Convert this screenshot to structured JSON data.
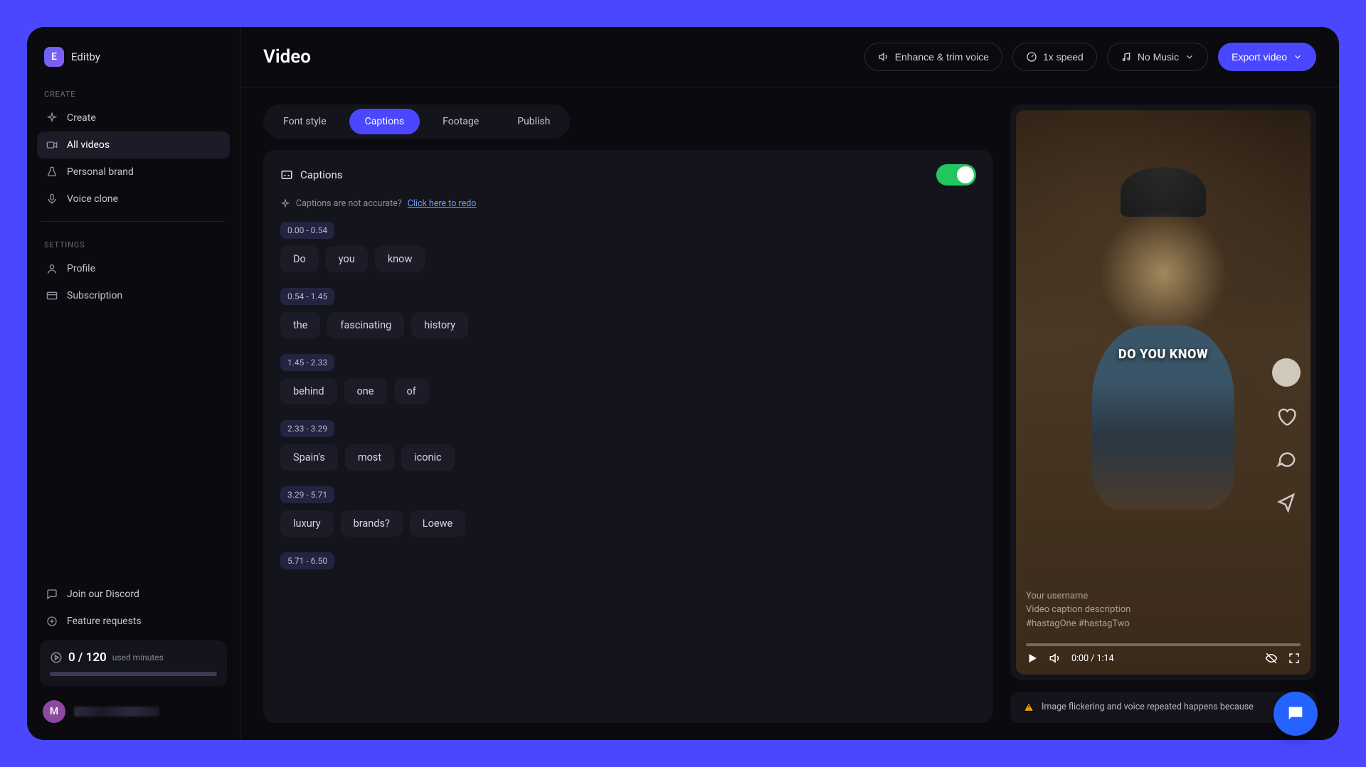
{
  "brand": {
    "initial": "E",
    "name": "Editby"
  },
  "sidebar": {
    "section_create": "CREATE",
    "section_settings": "SETTINGS",
    "items_create": [
      {
        "label": "Create"
      },
      {
        "label": "All videos"
      },
      {
        "label": "Personal brand"
      },
      {
        "label": "Voice clone"
      }
    ],
    "items_settings": [
      {
        "label": "Profile"
      },
      {
        "label": "Subscription"
      }
    ],
    "footer": [
      {
        "label": "Join our Discord"
      },
      {
        "label": "Feature requests"
      }
    ]
  },
  "usage": {
    "main": "0 / 120",
    "sub": "used minutes"
  },
  "avatar_initial": "M",
  "header": {
    "title": "Video",
    "enhance": "Enhance & trim voice",
    "speed": "1x speed",
    "music": "No Music",
    "export": "Export video"
  },
  "tabs": [
    "Font style",
    "Captions",
    "Footage",
    "Publish"
  ],
  "captions": {
    "title": "Captions",
    "redo_prompt": "Captions are not accurate?",
    "redo_link": "Click here to redo",
    "segments": [
      {
        "time": "0.00 - 0.54",
        "words": [
          "Do",
          "you",
          "know"
        ]
      },
      {
        "time": "0.54 - 1.45",
        "words": [
          "the",
          "fascinating",
          "history"
        ]
      },
      {
        "time": "1.45 - 2.33",
        "words": [
          "behind",
          "one",
          "of"
        ]
      },
      {
        "time": "2.33 - 3.29",
        "words": [
          "Spain's",
          "most",
          "iconic"
        ]
      },
      {
        "time": "3.29 - 5.71",
        "words": [
          "luxury",
          "brands?",
          "Loewe"
        ]
      },
      {
        "time": "5.71 - 6.50",
        "words": []
      }
    ]
  },
  "preview": {
    "caption_text": "DO YOU KNOW",
    "username": "Your username",
    "description": "Video caption description",
    "hashtags": "#hastagOne #hastagTwo",
    "time": "0:00 / 1:14"
  },
  "warning": "Image flickering and voice repeated happens because"
}
